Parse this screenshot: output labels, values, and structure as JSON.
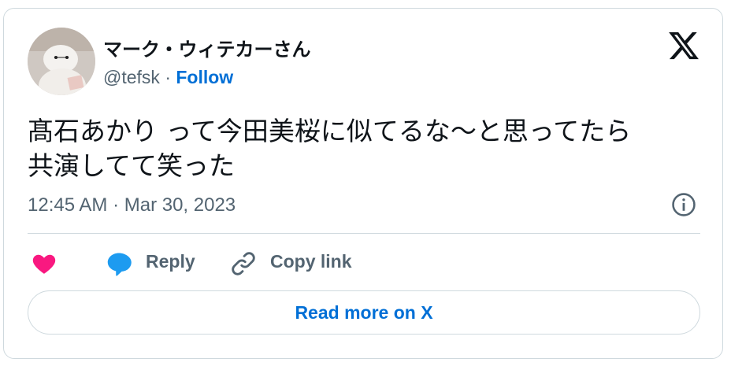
{
  "tweet": {
    "author_name": "マーク・ウィテカーさん",
    "handle": "@tefsk",
    "separator": "·",
    "follow_label": "Follow",
    "text_line1": "髙石あかり って今田美桜に似てるな〜と思ってたら",
    "text_line2": "共演してて笑った",
    "timestamp": "12:45 AM · Mar 30, 2023"
  },
  "actions": {
    "reply_label": "Reply",
    "copy_link_label": "Copy link",
    "read_more_label": "Read more on X"
  },
  "colors": {
    "link_blue": "#006fd6",
    "heart_pink": "#f91880",
    "reply_blue": "#1d9bf0",
    "secondary_text": "#536471",
    "border": "#cfd9de"
  },
  "icons": [
    "x-logo-icon",
    "info-icon",
    "heart-icon",
    "reply-bubble-icon",
    "link-icon"
  ]
}
